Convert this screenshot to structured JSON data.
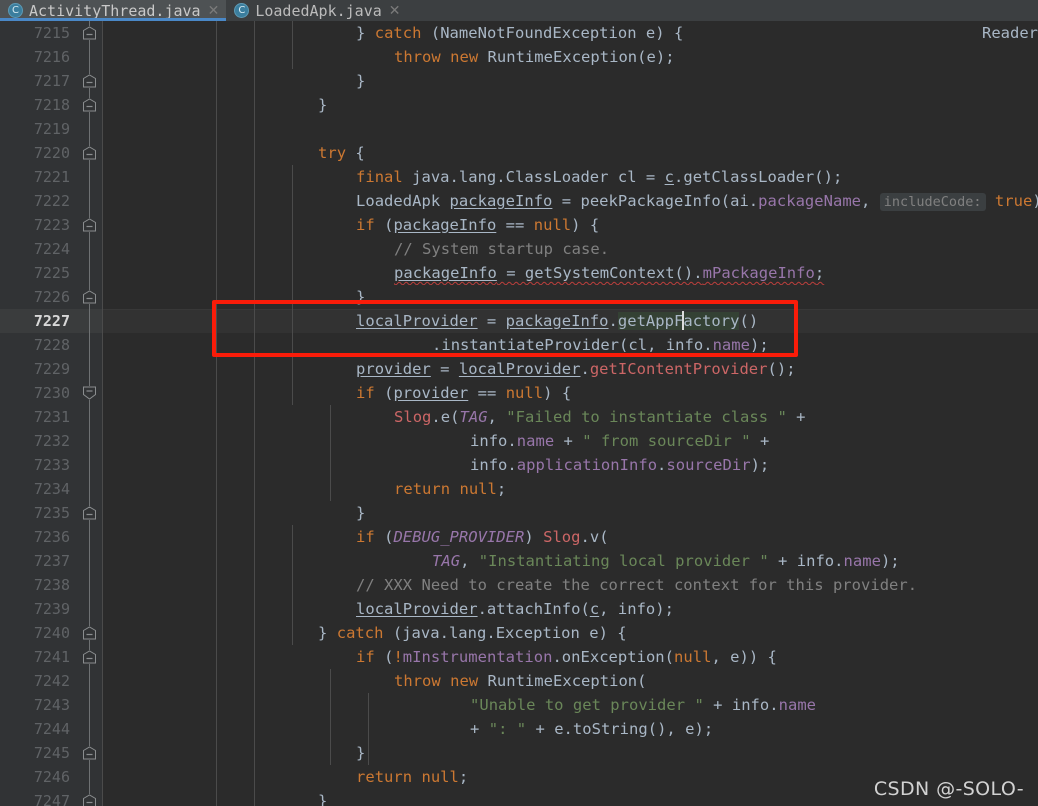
{
  "app": {
    "theme": "darcula",
    "colors": {
      "editor_bg": "#2b2b2b",
      "gutter_bg": "#313335",
      "current_line_bg": "#323232",
      "tab_bar_bg": "#3c3f41",
      "active_tab_bg": "#4e5254",
      "active_tab_underline": "#4a88c7",
      "default_text": "#a9b7c6",
      "keyword": "#cc7832",
      "string": "#6a8759",
      "comment": "#808080",
      "field": "#9876aa",
      "constant_italic": "#9876aa",
      "error": "#cc6666",
      "number": "#6897bb",
      "annotation_box": "#fa1c09",
      "caret": "#dcdcdc",
      "identifier_highlight": "#344134"
    }
  },
  "tab_bar": {
    "tabs": [
      {
        "label": "ActivityThread.java",
        "icon": "java-class-icon",
        "glyph": "C",
        "close_glyph": "✕",
        "active": true
      },
      {
        "label": "LoadedApk.java",
        "icon": "java-class-icon",
        "glyph": "C",
        "close_glyph": "✕",
        "active": false
      }
    ]
  },
  "editor": {
    "language": "java",
    "current_line": 7227,
    "caret": {
      "line": 7227,
      "after_text": "localProvider = packageInfo.getAppF"
    },
    "right_overflow_text": "Reader",
    "first_visible_line": 7215,
    "last_visible_line": 7247,
    "line_numbers": [
      "7215",
      "7216",
      "7217",
      "7218",
      "7219",
      "7220",
      "7221",
      "7222",
      "7223",
      "7224",
      "7225",
      "7226",
      "7227",
      "7228",
      "7229",
      "7230",
      "7231",
      "7232",
      "7233",
      "7234",
      "7235",
      "7236",
      "7237",
      "7238",
      "7239",
      "7240",
      "7241",
      "7242",
      "7243",
      "7244",
      "7245",
      "7246",
      "7247"
    ],
    "fold_marker_lines": [
      "7215",
      "7217",
      "7218",
      "7220",
      "7226",
      "7230",
      "7235",
      "7240",
      "7241",
      "7245",
      "7247"
    ],
    "code_lines": [
      "            } catch (NameNotFoundException e) {",
      "                throw new RuntimeException(e);",
      "            }",
      "        }",
      "",
      "        try {",
      "            final java.lang.ClassLoader cl = c.getClassLoader();",
      "            LoadedApk packageInfo = peekPackageInfo(ai.packageName, includeCode: true);",
      "            if (packageInfo == null) {",
      "                // System startup case.",
      "                packageInfo = getSystemContext().mPackageInfo;",
      "            }",
      "            localProvider = packageInfo.getAppFactory()",
      "                    .instantiateProvider(cl, info.name);",
      "            provider = localProvider.getIContentProvider();",
      "            if (provider == null) {",
      "                Slog.e(TAG, \"Failed to instantiate class \" +",
      "                        info.name + \" from sourceDir \" +",
      "                        info.applicationInfo.sourceDir);",
      "                return null;",
      "            }",
      "            if (DEBUG_PROVIDER) Slog.v(",
      "                    TAG, \"Instantiating local provider \" + info.name);",
      "            // XXX Need to create the correct context for this provider.",
      "            localProvider.attachInfo(c, info);",
      "        } catch (java.lang.Exception e) {",
      "            if (!mInstrumentation.onException(null, e)) {",
      "                throw new RuntimeException(",
      "                        \"Unable to get provider \" + info.name",
      "                        + \": \" + e.toString(), e);",
      "            }",
      "            return null;",
      "        }"
    ],
    "annotation": {
      "type": "red-rectangle-highlight",
      "lines": [
        "7227",
        "7228"
      ],
      "color": "#fa1c09"
    }
  },
  "watermark": {
    "text": "CSDN @-SOLO-"
  }
}
